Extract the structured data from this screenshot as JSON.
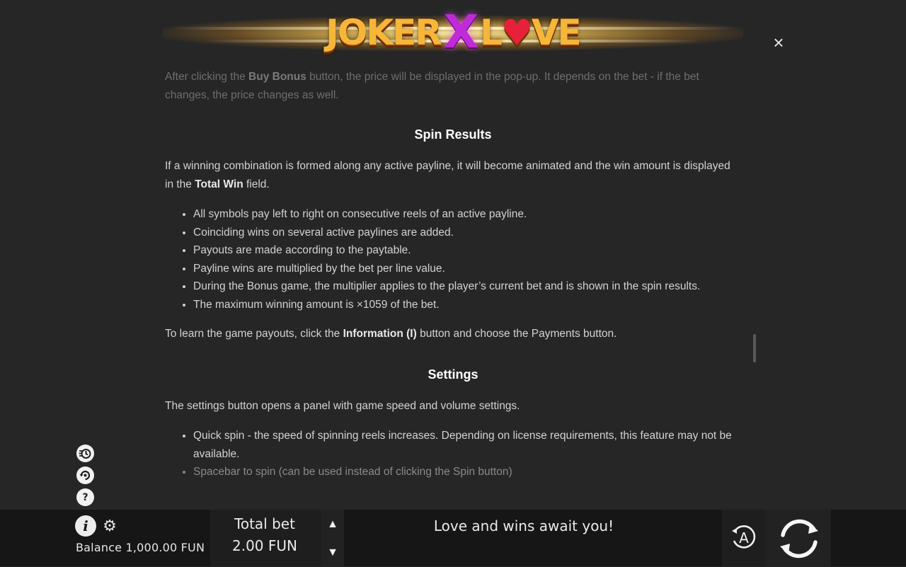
{
  "header": {
    "logo_joker": "JOKER",
    "logo_x": "X",
    "logo_l": "L",
    "logo_heart": "♥",
    "logo_ve": "VE",
    "close_label": "×"
  },
  "content": {
    "buy_bonus_text_1": "After clicking the ",
    "buy_bonus_bold": "Buy Bonus",
    "buy_bonus_text_2": " button, the price will be displayed in the pop-up. It depends on the bet - if the bet changes, the price changes as well.",
    "spin_results_heading": "Spin Results",
    "spin_results_text_1": "If a winning combination is formed along any active payline, it will become animated and the win amount is displayed in the ",
    "spin_results_bold": "Total Win",
    "spin_results_text_2": " field.",
    "spin_results_items": [
      "All symbols pay left to right on consecutive reels of an active payline.",
      "Coinciding wins on several active paylines are added.",
      "Payouts are made according to the paytable.",
      "Payline wins are multiplied by the bet per line value.",
      "During the Bonus game, the multiplier applies to the player’s current bet and is shown in the spin results.",
      "The maximum winning amount is ×1059 of the bet."
    ],
    "payouts_text_1": "To learn the game payouts, click the ",
    "payouts_bold": "Information (I)",
    "payouts_text_2": " button and choose the Payments button.",
    "settings_heading": "Settings",
    "settings_text": "The settings button opens a panel with game speed and volume settings.",
    "settings_items": [
      "Quick spin - the speed of spinning reels increases. Depending on license requirements, this feature may not be available.",
      "Spacebar to spin (can be used instead of clicking the Spin button)"
    ]
  },
  "side_icons": {
    "turbo": "⚡",
    "autoplay": "↻",
    "help": "?"
  },
  "bottom_bar": {
    "info_label": "i",
    "gear_label": "⚙",
    "balance_label": "Balance",
    "balance_value": "1,000.00 FUN",
    "total_bet_label": "Total bet",
    "total_bet_value": "2.00 FUN",
    "bet_up": "▲",
    "bet_down": "▼",
    "message": "Love and wins await you!",
    "auto_label": "A"
  }
}
